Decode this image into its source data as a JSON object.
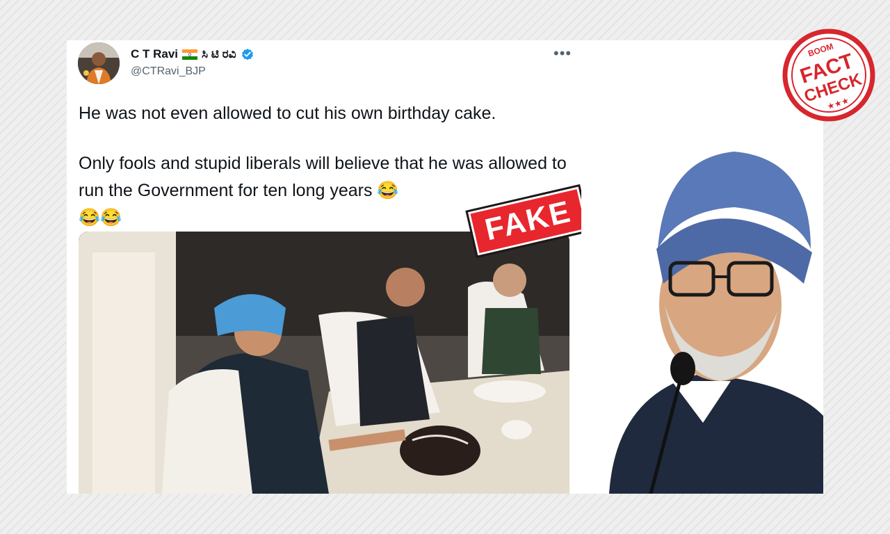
{
  "tweet": {
    "display_name": "C T Ravi",
    "name_kannada": "ಸಿ ಟಿ ರವಿ",
    "handle": "@CTRavi_BJP",
    "more_glyph": "•••",
    "line1": "He was not even allowed to cut his own birthday cake.",
    "line2": "Only fools and stupid liberals will believe that he was allowed to run the Government for ten long years 😂",
    "line3": "😂😂"
  },
  "overlay": {
    "fake_label": "FAKE",
    "stamp_top": "BOOM",
    "stamp_main": "FACT",
    "stamp_sub": "CHECK",
    "stamp_stars": "★★★"
  },
  "colors": {
    "verified_blue": "#1d9bf0",
    "stamp_red": "#d7262d",
    "fake_red": "#e8262d",
    "turban_blue": "#5a79b8"
  },
  "icons": {
    "flag": "india-flag-icon",
    "verified": "verified-badge-icon",
    "more": "more-options-icon"
  }
}
